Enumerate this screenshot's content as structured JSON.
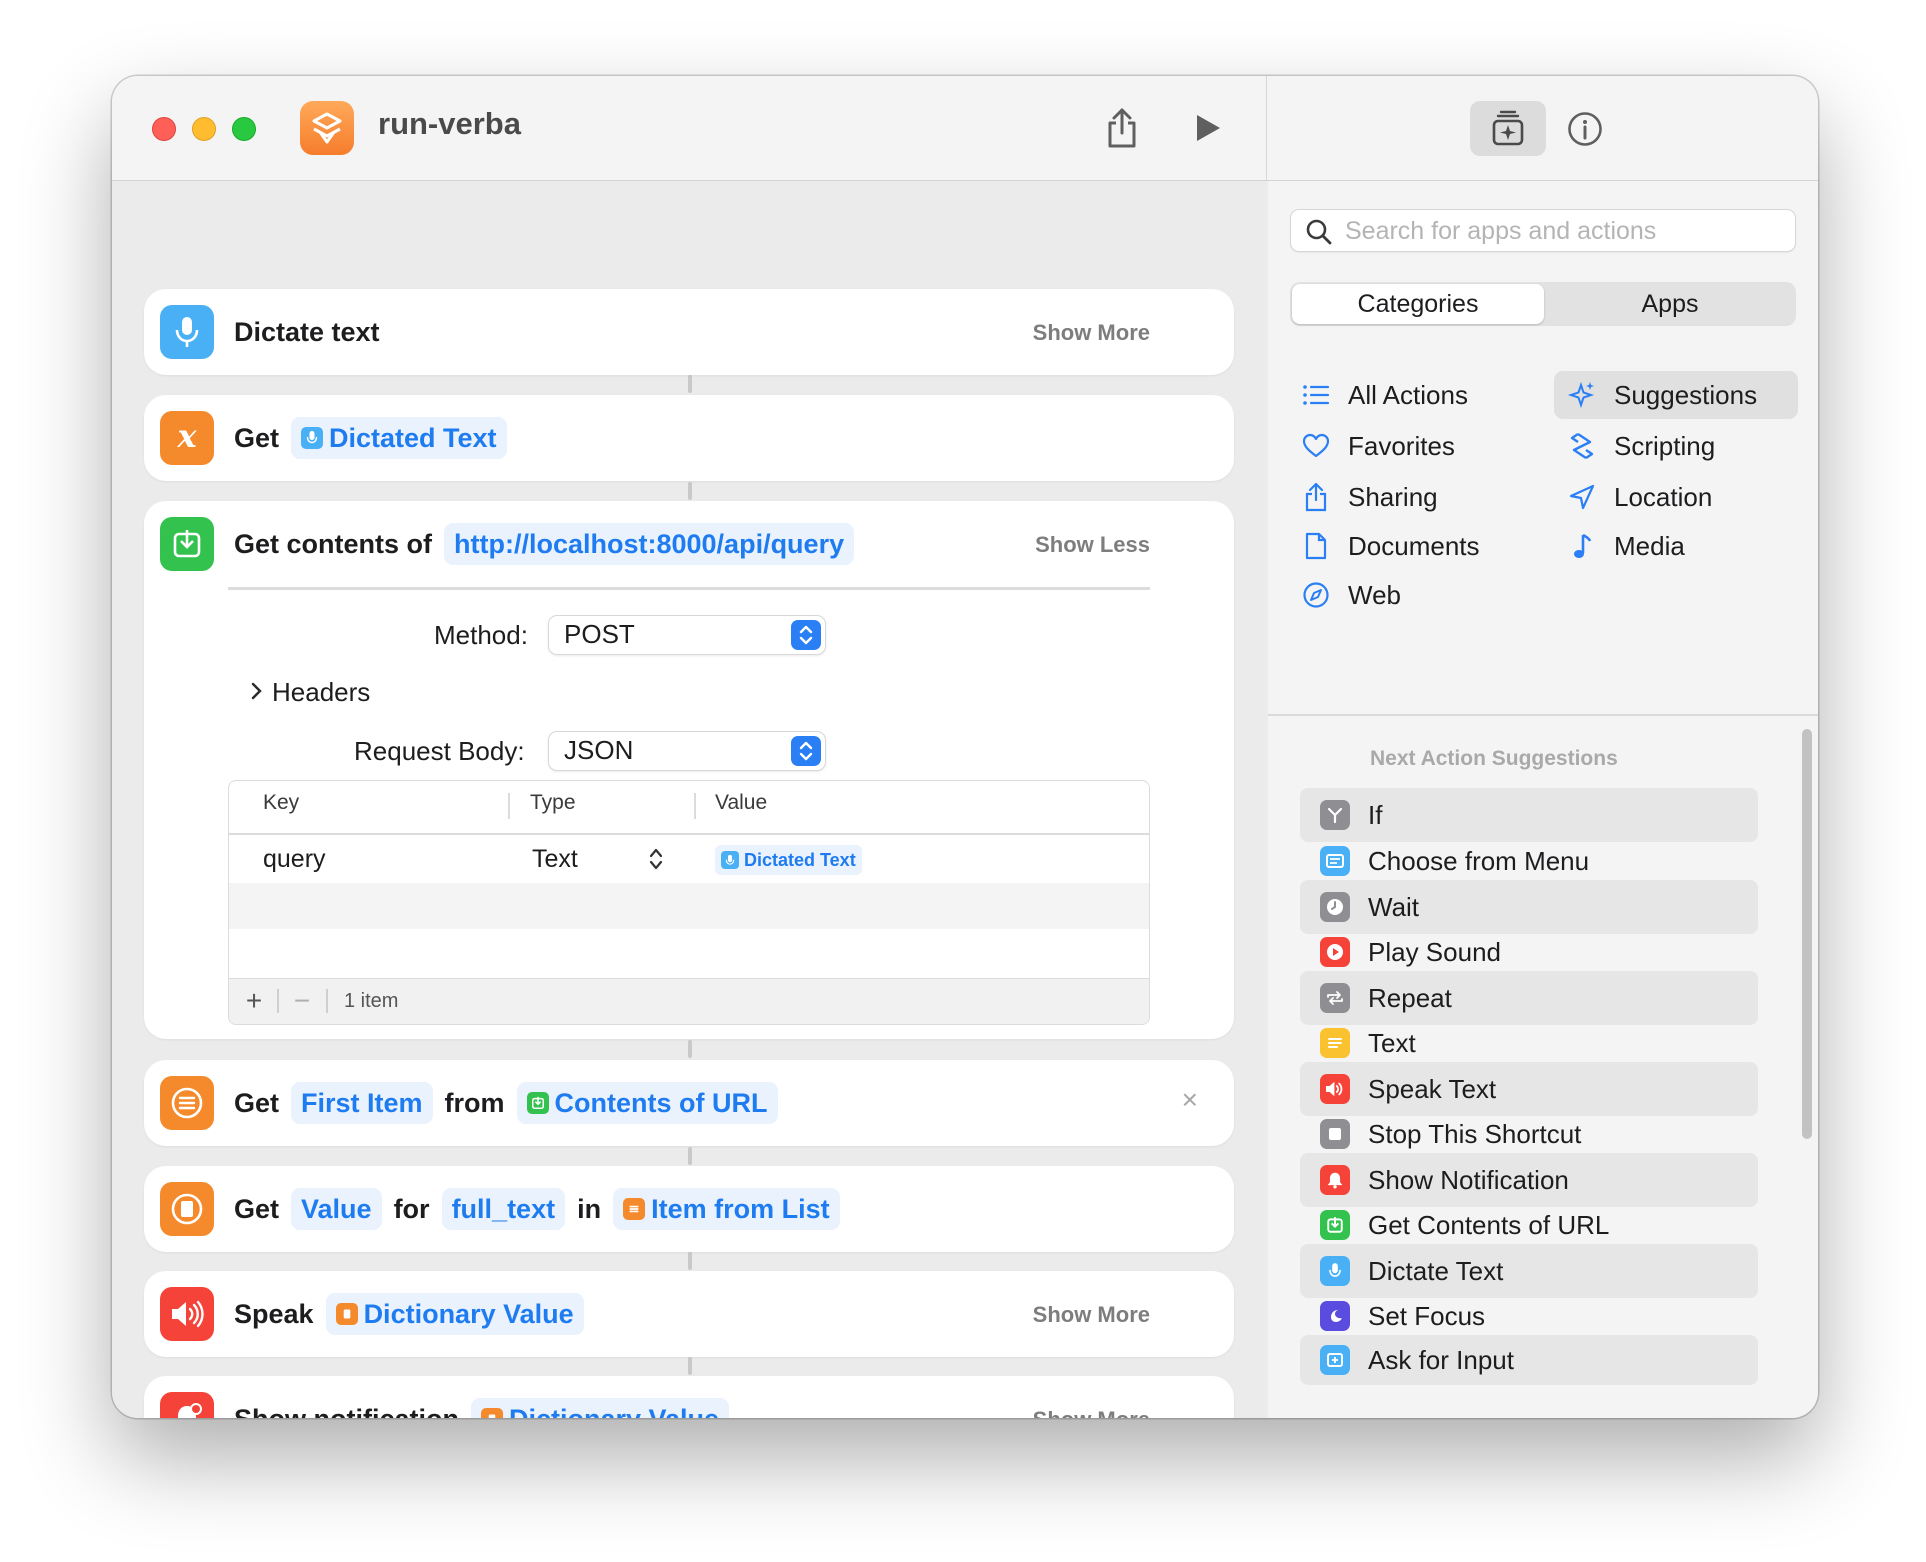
{
  "window": {
    "title": "run-verba"
  },
  "toolbar": {
    "share_icon": "share-icon",
    "run_icon": "play-icon",
    "library_icon": "action-library-icon",
    "info_icon": "info-icon"
  },
  "actions": [
    {
      "id": "dictate",
      "icon": "microphone-icon",
      "color": "#4ab0f5",
      "words": [
        "Dictate text"
      ],
      "right": "Show More"
    },
    {
      "id": "get-variable",
      "icon": "variable-icon",
      "color": "#f58a2c",
      "words": [
        "Get"
      ],
      "tokens": [
        {
          "label": "Dictated Text",
          "icon": "microphone-icon",
          "color": "#4ab0f5"
        }
      ]
    },
    {
      "id": "get-contents",
      "icon": "download-icon",
      "color": "#33c24d",
      "words": [
        "Get contents of"
      ],
      "tokens": [
        {
          "label": "http://localhost:8000/api/query"
        }
      ],
      "right": "Show Less",
      "method_label": "Method:",
      "method_value": "POST",
      "headers_label": "Headers",
      "body_label": "Request Body:",
      "body_value": "JSON",
      "table": {
        "columns": [
          "Key",
          "Type",
          "Value"
        ],
        "rows": [
          {
            "key": "query",
            "type": "Text",
            "value": "Dictated Text"
          }
        ],
        "footer": "1 item"
      }
    },
    {
      "id": "get-item",
      "icon": "list-icon",
      "color": "#f58a2c",
      "words": [
        "Get",
        "from"
      ],
      "tokens": [
        {
          "label": "First Item"
        },
        {
          "label": "Contents of URL",
          "icon": "download-icon",
          "color": "#33c24d"
        }
      ],
      "right": "×"
    },
    {
      "id": "get-value",
      "icon": "dictionary-icon",
      "color": "#f58a2c",
      "words": [
        "Get",
        "for",
        "in"
      ],
      "tokens": [
        {
          "label": "Value"
        },
        {
          "label": "full_text"
        },
        {
          "label": "Item from List",
          "icon": "list-icon",
          "color": "#f58a2c"
        }
      ]
    },
    {
      "id": "speak",
      "icon": "speaker-icon",
      "color": "#f5433a",
      "words": [
        "Speak"
      ],
      "tokens": [
        {
          "label": "Dictionary Value",
          "icon": "dictionary-icon",
          "color": "#f58a2c"
        }
      ],
      "right": "Show More"
    },
    {
      "id": "notify",
      "icon": "bell-icon",
      "color": "#f5433a",
      "words": [
        "Show notification"
      ],
      "tokens": [
        {
          "label": "Dictionary Value",
          "icon": "dictionary-icon",
          "color": "#f58a2c"
        }
      ],
      "right": "Show More"
    }
  ],
  "sidebar": {
    "search_placeholder": "Search for apps and actions",
    "segments": [
      "Categories",
      "Apps"
    ],
    "categories": [
      {
        "label": "All Actions",
        "icon": "list-icon"
      },
      {
        "label": "Suggestions",
        "icon": "sparkle-icon",
        "selected": true
      },
      {
        "label": "Favorites",
        "icon": "heart-icon"
      },
      {
        "label": "Scripting",
        "icon": "scripting-icon"
      },
      {
        "label": "Sharing",
        "icon": "share-icon"
      },
      {
        "label": "Location",
        "icon": "location-icon"
      },
      {
        "label": "Documents",
        "icon": "document-icon"
      },
      {
        "label": "Media",
        "icon": "music-note-icon"
      },
      {
        "label": "Web",
        "icon": "compass-icon"
      }
    ],
    "suggestions_title": "Next Action Suggestions",
    "suggestions": [
      {
        "label": "If",
        "icon": "if-icon",
        "color": "#8e8e93"
      },
      {
        "label": "Choose from Menu",
        "icon": "menu-icon",
        "color": "#4ab0f5"
      },
      {
        "label": "Wait",
        "icon": "clock-icon",
        "color": "#8e8e93"
      },
      {
        "label": "Play Sound",
        "icon": "play-sound-icon",
        "color": "#f5433a"
      },
      {
        "label": "Repeat",
        "icon": "repeat-icon",
        "color": "#8e8e93"
      },
      {
        "label": "Text",
        "icon": "text-icon",
        "color": "#f9c22e"
      },
      {
        "label": "Speak Text",
        "icon": "speaker-icon",
        "color": "#f5433a"
      },
      {
        "label": "Stop This Shortcut",
        "icon": "stop-icon",
        "color": "#8e8e93"
      },
      {
        "label": "Show Notification",
        "icon": "bell-icon",
        "color": "#f5433a"
      },
      {
        "label": "Get Contents of URL",
        "icon": "download-icon",
        "color": "#33c24d"
      },
      {
        "label": "Dictate Text",
        "icon": "microphone-icon",
        "color": "#4ab0f5"
      },
      {
        "label": "Set Focus",
        "icon": "moon-icon",
        "color": "#5b4ce0"
      },
      {
        "label": "Ask for Input",
        "icon": "input-icon",
        "color": "#4ab0f5"
      }
    ]
  }
}
